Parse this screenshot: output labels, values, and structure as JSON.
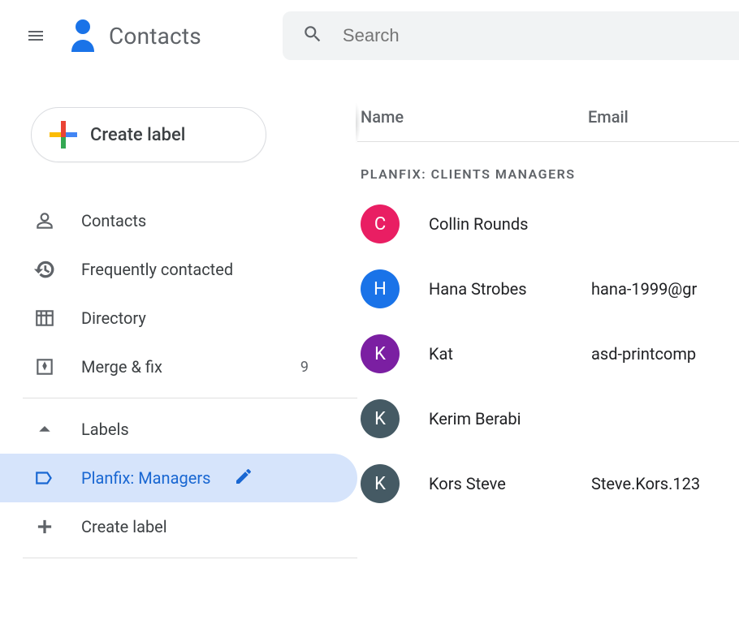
{
  "header": {
    "app_title": "Contacts",
    "search_placeholder": "Search"
  },
  "sidebar": {
    "create_label": "Create label",
    "nav": {
      "contacts": "Contacts",
      "frequent": "Frequently contacted",
      "directory": "Directory",
      "merge_fix": "Merge & fix",
      "merge_fix_count": "9"
    },
    "labels_header": "Labels",
    "label_selected": "Planfix: Managers"
  },
  "main": {
    "col_name": "Name",
    "col_email": "Email",
    "group_title": "PLANFIX: CLIENTS MANAGERS",
    "contacts": [
      {
        "initial": "C",
        "color": "c-pink",
        "name": "Collin Rounds",
        "email": ""
      },
      {
        "initial": "H",
        "color": "c-blue",
        "name": "Hana Strobes",
        "email": "hana-1999@gr"
      },
      {
        "initial": "K",
        "color": "c-purple",
        "name": "Kat",
        "email": "asd-printcomp"
      },
      {
        "initial": "K",
        "color": "c-grey",
        "name": "Kerim Berabi",
        "email": ""
      },
      {
        "initial": "K",
        "color": "c-grey",
        "name": "Kors Steve",
        "email": "Steve.Kors.123"
      }
    ]
  }
}
